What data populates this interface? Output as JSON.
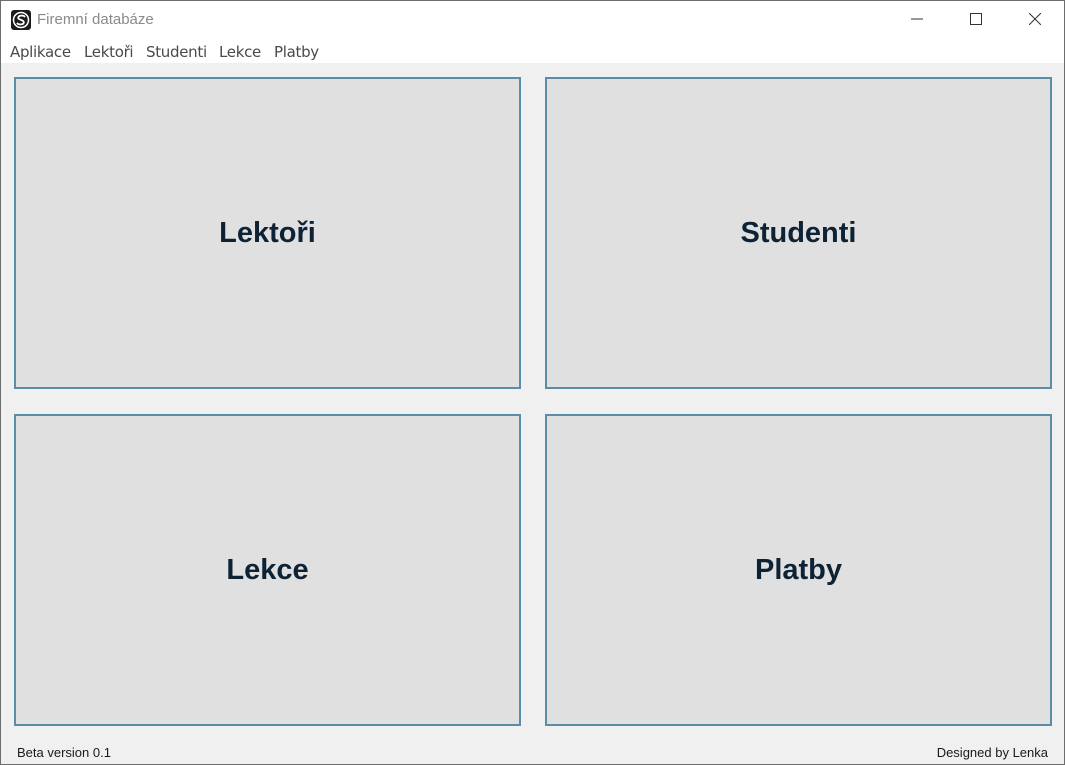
{
  "window": {
    "title": "Firemní databáze",
    "controls": [
      "minimize-icon",
      "maximize-icon",
      "close-icon"
    ]
  },
  "menu": {
    "items": [
      {
        "label": "Aplikace"
      },
      {
        "label": "Lektoři"
      },
      {
        "label": "Studenti"
      },
      {
        "label": "Lekce"
      },
      {
        "label": "Platby"
      }
    ]
  },
  "tiles": [
    {
      "label": "Lektoři"
    },
    {
      "label": "Studenti"
    },
    {
      "label": "Lekce"
    },
    {
      "label": "Platby"
    }
  ],
  "status": {
    "version": "Beta version 0.1",
    "credit": "Designed by Lenka"
  },
  "colors": {
    "tile_background": "#e0e0e0",
    "tile_border": "#5b8ea6",
    "tile_text": "#0d2235",
    "window_background": "#f0f0f0"
  }
}
